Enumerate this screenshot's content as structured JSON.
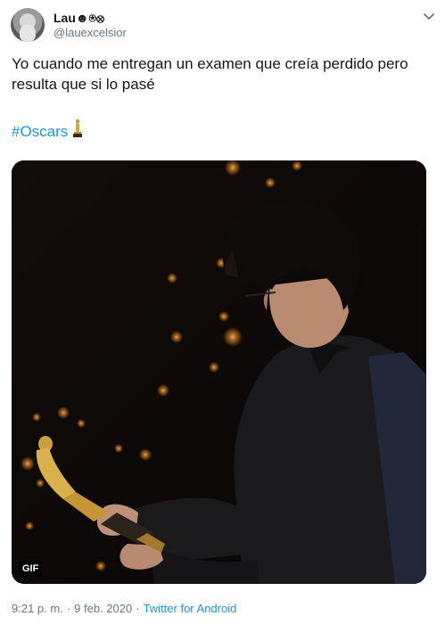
{
  "author": {
    "display_name": "Lau☻⍟⊗",
    "handle": "@lauexcelsior"
  },
  "tweet": {
    "text": "Yo cuando me entregan un examen que creía perdido pero resulta que si lo pasé",
    "hashtag": "#Oscars"
  },
  "media": {
    "badge": "GIF"
  },
  "meta": {
    "time": "9:21 p. m.",
    "separator": "·",
    "date": "9 feb. 2020",
    "source": "Twitter for Android"
  },
  "colors": {
    "link": "#1b95e0",
    "secondary_text": "#657786",
    "primary_text": "#14171a"
  },
  "icons": {
    "caret": "chevron-down-icon",
    "trophy": "trophy-icon"
  }
}
